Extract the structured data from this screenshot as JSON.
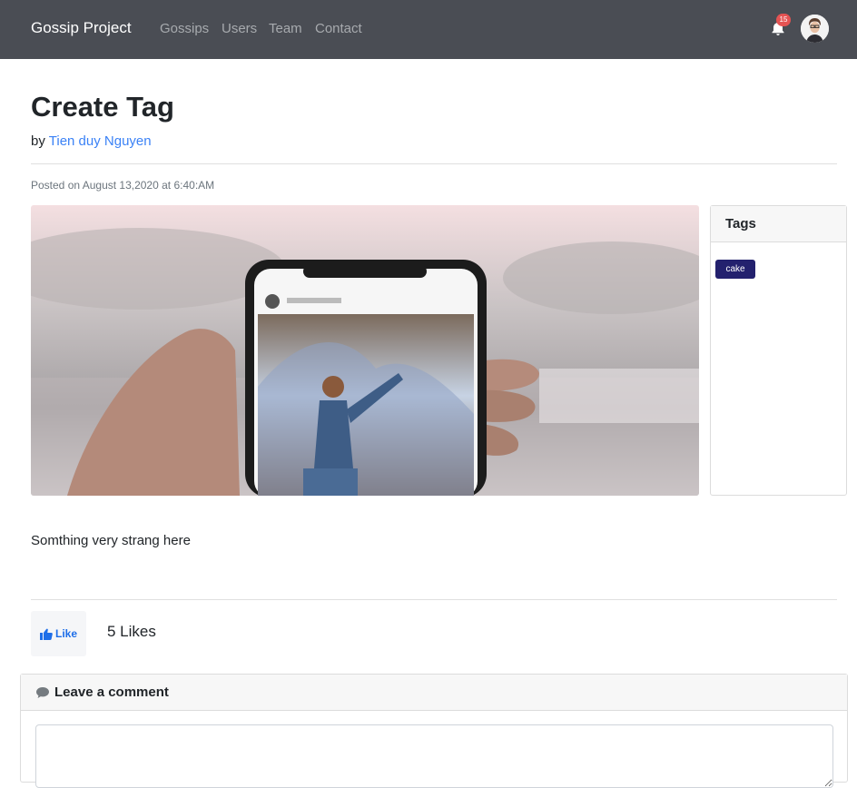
{
  "navbar": {
    "brand": "Gossip Project",
    "links": [
      "Gossips",
      "Users",
      "Team",
      "Contact"
    ],
    "notification_count": "15",
    "bell_icon": "bell-icon",
    "avatar_icon": "user-avatar"
  },
  "post": {
    "title": "Create Tag",
    "by_prefix": "by",
    "author": "Tien duy Nguyen",
    "posted": "Posted on August 13,2020 at 6:40:AM",
    "body": "Somthing very strang here"
  },
  "tags": {
    "header": "Tags",
    "items": [
      "cake"
    ]
  },
  "likes": {
    "button_label": "Like",
    "icon": "thumbs-up-icon",
    "count": "5 Likes"
  },
  "comment": {
    "header": "Leave a comment",
    "icon": "comment-icon",
    "value": ""
  },
  "colors": {
    "navbar": "#4a4d54",
    "link": "#3b82f6",
    "tag_badge": "#23216e",
    "like": "#1e6ee8",
    "badge": "#e55353"
  }
}
